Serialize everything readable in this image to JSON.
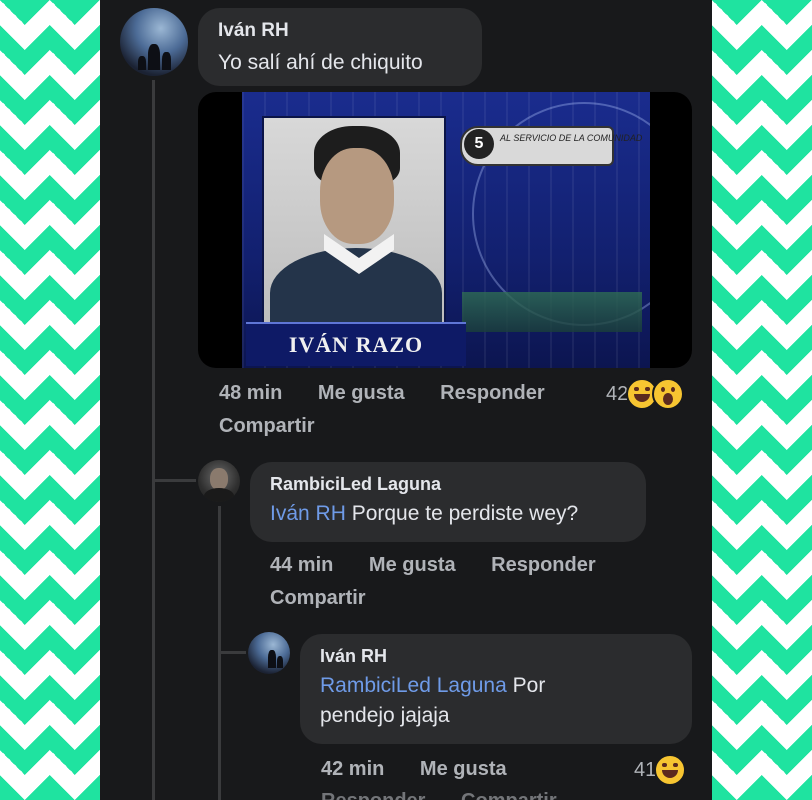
{
  "comments": [
    {
      "author": "Iván RH",
      "text": "Yo salí ahí de chiquito",
      "media": {
        "caption": "IVÁN RAZO",
        "channel_number": "5",
        "channel_slogan": "AL SERVICIO DE LA COMUNIDAD"
      },
      "time": "48 min",
      "like_label": "Me gusta",
      "reply_label": "Responder",
      "share_label": "Compartir",
      "reaction_count": "42",
      "reactions": [
        "haha",
        "wow"
      ]
    },
    {
      "author": "RambiciLed Laguna",
      "mention": "Iván RH",
      "text": "Porque te perdiste wey?",
      "time": "44 min",
      "like_label": "Me gusta",
      "reply_label": "Responder",
      "share_label": "Compartir"
    },
    {
      "author": "Iván RH",
      "mention": "RambiciLed Laguna",
      "text_after_mention": "Por",
      "text_line2": "pendejo jajaja",
      "time": "42 min",
      "like_label": "Me gusta",
      "reply_label": "Responder",
      "share_label": "Compartir",
      "reaction_count": "41",
      "reactions": [
        "haha"
      ]
    }
  ],
  "colors": {
    "background": "#18191b",
    "bubble": "#2b2c2e",
    "mention": "#6f9be8",
    "secondary_text": "#b0b3b8",
    "chevron": "#1fe3a0"
  }
}
